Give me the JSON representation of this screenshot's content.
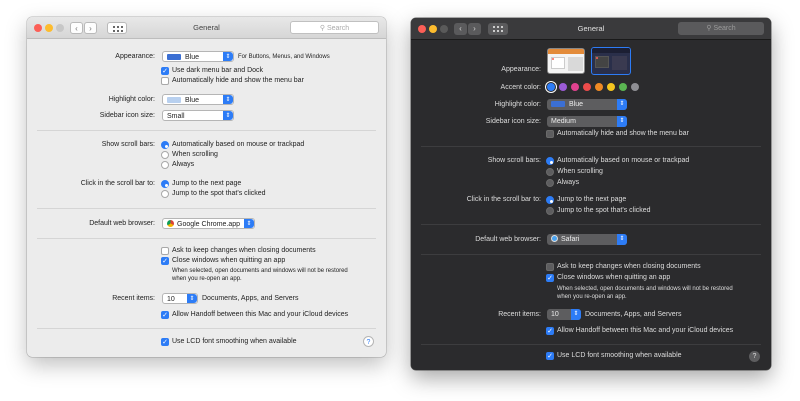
{
  "light": {
    "title": "General",
    "search_placeholder": "Search",
    "appearance_label": "Appearance:",
    "appearance_value": "Blue",
    "appearance_note": "For Buttons, Menus, and Windows",
    "dark_menu_label": "Use dark menu bar and Dock",
    "auto_hide_label": "Automatically hide and show the menu bar",
    "highlight_label": "Highlight color:",
    "highlight_value": "Blue",
    "sidebar_label": "Sidebar icon size:",
    "sidebar_value": "Small",
    "scroll_label": "Show scroll bars:",
    "scroll_options": [
      "Automatically based on mouse or trackpad",
      "When scrolling",
      "Always"
    ],
    "click_label": "Click in the scroll bar to:",
    "click_options": [
      "Jump to the next page",
      "Jump to the spot that's clicked"
    ],
    "browser_label": "Default web browser:",
    "browser_value": "Google Chrome.app",
    "ask_keep_label": "Ask to keep changes when closing documents",
    "close_windows_label": "Close windows when quitting an app",
    "close_note_1": "When selected, open documents and windows will not be restored",
    "close_note_2": "when you re-open an app.",
    "recent_label": "Recent items:",
    "recent_value": "10",
    "recent_note": "Documents, Apps, and Servers",
    "handoff_label": "Allow Handoff between this Mac and your iCloud devices",
    "lcd_label": "Use LCD font smoothing when available",
    "help": "?"
  },
  "dark": {
    "title": "General",
    "search_placeholder": "Search",
    "appearance_label": "Appearance:",
    "accent_label": "Accent color:",
    "accent_colors": [
      "#2d7cf6",
      "#9b5bd6",
      "#e0428f",
      "#ec4b4b",
      "#f08a24",
      "#f4c51f",
      "#5ab552",
      "#8e8e93"
    ],
    "highlight_label": "Highlight color:",
    "highlight_value": "Blue",
    "sidebar_label": "Sidebar icon size:",
    "sidebar_value": "Medium",
    "auto_hide_label": "Automatically hide and show the menu bar",
    "scroll_label": "Show scroll bars:",
    "scroll_options": [
      "Automatically based on mouse or trackpad",
      "When scrolling",
      "Always"
    ],
    "click_label": "Click in the scroll bar to:",
    "click_options": [
      "Jump to the next page",
      "Jump to the spot that's clicked"
    ],
    "browser_label": "Default web browser:",
    "browser_value": "Safari",
    "ask_keep_label": "Ask to keep changes when closing documents",
    "close_windows_label": "Close windows when quitting an app",
    "close_note_1": "When selected, open documents and windows will not be restored",
    "close_note_2": "when you re-open an app.",
    "recent_label": "Recent items:",
    "recent_value": "10",
    "recent_note": "Documents, Apps, and Servers",
    "handoff_label": "Allow Handoff between this Mac and your iCloud devices",
    "lcd_label": "Use LCD font smoothing when available",
    "help": "?"
  },
  "colors": {
    "accent": "#2d7cf6",
    "blue_swatch": "#3b6fd3",
    "highlight_swatch": "#b8d0ef"
  },
  "icons": {
    "back": "chevron-left-icon",
    "forward": "chevron-right-icon",
    "grid": "grid-icon",
    "search": "search-icon",
    "chrome": "chrome-icon",
    "safari": "safari-icon",
    "check": "checkmark-icon",
    "help": "help-icon"
  }
}
